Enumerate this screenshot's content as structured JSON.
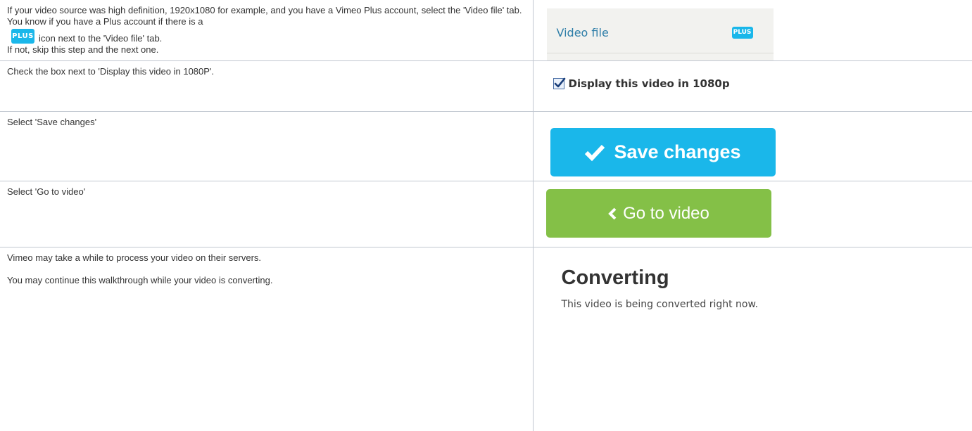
{
  "colors": {
    "vimeo_blue": "#1ab7ea",
    "vimeo_green": "#84c047",
    "tab_link": "#2e7ea8",
    "table_border": "#c1c7d0"
  },
  "rows": [
    {
      "text_a": "If your video source was high definition, 1920x1080 for example, and you have a Vimeo Plus account, select the 'Video file' tab.  You know if you have a Plus account if there is a",
      "inline_badge": "PLUS",
      "text_b": "icon next to the 'Video file' tab.",
      "text_c": "If not, skip this step and the next one.",
      "image": {
        "tab_label": "Video file",
        "badge": "PLUS"
      }
    },
    {
      "text": "Check the box next to 'Display this video in 1080P'.",
      "image": {
        "checkbox_label": "Display this video in 1080p",
        "checked": true,
        "icon": "checkbox-checked-icon"
      }
    },
    {
      "text": "Select 'Save changes'",
      "image": {
        "button_label": "Save changes",
        "icon": "checkmark-icon"
      }
    },
    {
      "text": "Select 'Go to video'",
      "image": {
        "button_label": "Go to video",
        "icon": "chevron-left-icon"
      }
    },
    {
      "text_a": "Vimeo may take a while to process your video on their servers.",
      "text_b": "You may continue this walkthrough while your video is converting.",
      "image": {
        "heading": "Converting",
        "message": "This video is being converted right now."
      }
    }
  ]
}
